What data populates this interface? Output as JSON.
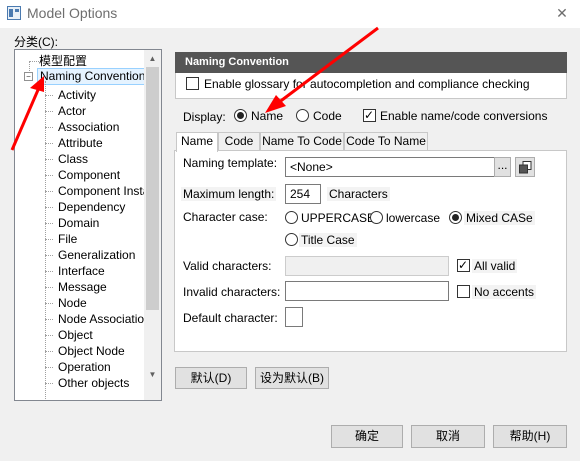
{
  "window": {
    "title": "Model Options",
    "close_glyph": "✕"
  },
  "category_label": "分类(C):",
  "tree": {
    "root_label": "模型配置",
    "expanded_label": "Naming Convention",
    "expander_glyph": "−",
    "children": [
      "Activity",
      "Actor",
      "Association",
      "Attribute",
      "Class",
      "Component",
      "Component Instan",
      "Dependency",
      "Domain",
      "File",
      "Generalization",
      "Interface",
      "Message",
      "Node",
      "Node Association",
      "Object",
      "Object Node",
      "Operation",
      "Other objects"
    ]
  },
  "panel": {
    "header": "Naming Convention",
    "glossary_label": "Enable glossary for autocompletion and compliance checking",
    "display_label": "Display:",
    "display_options": [
      "Name",
      "Code"
    ],
    "display_selected": "Name",
    "conversion_label": "Enable name/code conversions",
    "conversion_checked": true
  },
  "tabs": [
    "Name",
    "Code",
    "Name To Code",
    "Code To Name"
  ],
  "active_tab": "Name",
  "form": {
    "template_label": "Naming template:",
    "template_value": "<None>",
    "ellipsis_label": "...",
    "max_length_label": "Maximum length:",
    "max_length_value": "254",
    "max_length_unit": "Characters",
    "case_label": "Character case:",
    "case_options": [
      "UPPERCASE",
      "lowercase",
      "Mixed CASe",
      "Title Case"
    ],
    "case_selected": "Mixed CASe",
    "valid_label": "Valid characters:",
    "all_valid_label": "All valid",
    "all_valid_checked": true,
    "invalid_label": "Invalid characters:",
    "no_accents_label": "No accents",
    "no_accents_checked": false,
    "default_char_label": "Default character:"
  },
  "buttons": {
    "default": "默认(D)",
    "set_default": "设为默认(B)",
    "ok": "确定",
    "cancel": "取消",
    "help": "帮助(H)"
  },
  "colors": {
    "annotation_arrow": "#ff0000",
    "panel_header": "#555555"
  },
  "icons": [
    "model-options-icon",
    "close-icon",
    "tree-expander-icon",
    "dropdown-arrow-icon",
    "ellipsis-icon",
    "properties-icon",
    "annotation-arrow-icon"
  ]
}
